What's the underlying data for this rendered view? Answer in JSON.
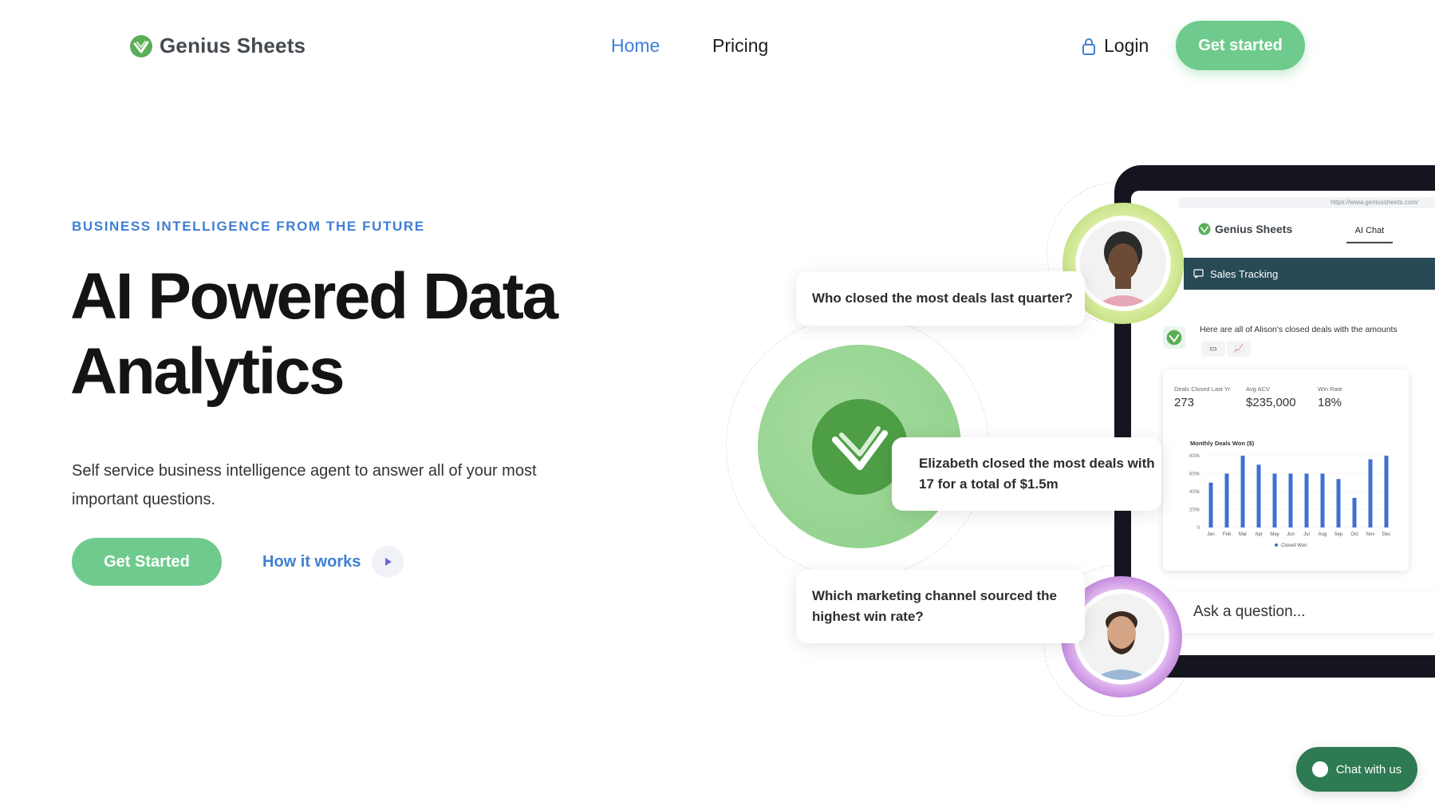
{
  "header": {
    "brand": "Genius Sheets",
    "nav": [
      {
        "label": "Home",
        "active": true
      },
      {
        "label": "Pricing",
        "active": false
      }
    ],
    "login_label": "Login",
    "cta_label": "Get started"
  },
  "hero": {
    "eyebrow": "BUSINESS INTELLIGENCE FROM THE FUTURE",
    "headline": "AI Powered Data Analytics",
    "subtext": "Self service business intelligence agent to answer all of your most important questions.",
    "cta_label": "Get Started",
    "secondary_label": "How it works"
  },
  "illustration": {
    "question_1": "Who closed the most deals last quarter?",
    "answer": "Elizabeth closed the most deals with 17 for a total of $1.5m",
    "question_2": "Which marketing channel sourced the highest win rate?",
    "app": {
      "url": "https://www.geniussheets.com/",
      "brand": "Genius Sheets",
      "tab": "AI Chat",
      "section": "Sales Tracking",
      "bot_message": "Here are all of Alison's closed deals with the amounts",
      "ask_placeholder": "Ask a question...",
      "kpis": [
        {
          "label": "Deals Closed Last Yr",
          "value": "273"
        },
        {
          "label": "Avg ACV",
          "value": "$235,000"
        },
        {
          "label": "Win Rate",
          "value": "18%"
        }
      ]
    }
  },
  "chart_data": {
    "type": "bar",
    "title": "Monthly Deals Won ($)",
    "categories": [
      "Jan",
      "Feb",
      "Mar",
      "Apr",
      "May",
      "Jun",
      "Jul",
      "Aug",
      "Sep",
      "Oct",
      "Nov",
      "Dec"
    ],
    "series": [
      {
        "name": "Closed Won",
        "values": [
          500,
          600,
          810,
          700,
          600,
          600,
          600,
          600,
          540,
          330,
          760,
          880
        ]
      }
    ],
    "ylim": [
      0,
      800
    ],
    "yticks": [
      "800k",
      "600k",
      "400k",
      "200k",
      "0"
    ]
  },
  "chat_widget_label": "Chat with us",
  "colors": {
    "accent_blue": "#3f7fd4",
    "brand_green": "#6fcb8d",
    "dark_green": "#2e7a52"
  }
}
